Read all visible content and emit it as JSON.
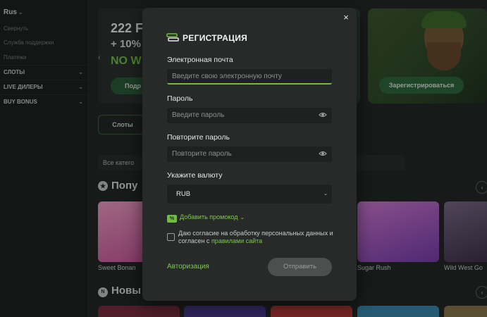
{
  "sidebar": {
    "language": "Rus",
    "links": [
      "Свернуть",
      "Служба поддержки",
      "Платежи"
    ],
    "sections": [
      "СЛОТЫ",
      "LIVE ДИЛЕРЫ",
      "BUY BONUS"
    ]
  },
  "banners": {
    "main_line1": "222 FI",
    "main_line2": "+ 10%",
    "main_line3": "NO W",
    "main_button": "Подр",
    "side_button": "Зарегистрироваться"
  },
  "tabs": {
    "slots": "Слоты"
  },
  "search": {
    "text": "Все катего"
  },
  "sections": {
    "popular": "Попу",
    "new": "Новы"
  },
  "games": [
    {
      "name": "Sweet Bonan",
      "color": "#d86aa8"
    },
    {
      "name": "Sugar Rush",
      "color": "#a84fc0"
    },
    {
      "name": "Wild West Go",
      "color": "#5a4a66"
    }
  ],
  "modal": {
    "title": "РЕГИСТРАЦИЯ",
    "close_label": "×",
    "email_label": "Электронная почта",
    "email_placeholder": "Введите свою электронную почту",
    "password_label": "Пароль",
    "password_placeholder": "Введите пароль",
    "repeat_label": "Повторите пароль",
    "repeat_placeholder": "Повторите пароль",
    "currency_label": "Укажите валюту",
    "currency_value": "RUB",
    "promo_label": "Добавить промокод",
    "consent_text_1": "Даю согласие на обработку персональных данных и согласен с ",
    "consent_link": "правилами сайта",
    "login_link": "Авторизация",
    "submit_label": "Отправить"
  },
  "colors": {
    "accent": "#6fbf3f",
    "modal_bg": "#272a29",
    "input_bg": "#1e2120"
  }
}
